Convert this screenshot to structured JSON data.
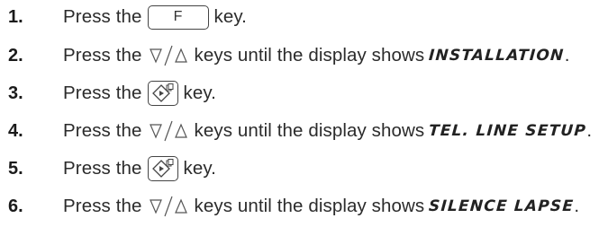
{
  "steps": [
    {
      "number": "1.",
      "text_before": "Press the",
      "key": {
        "label": "F",
        "icon": "f-key"
      },
      "text_after": "key."
    },
    {
      "number": "2.",
      "text_before": "Press the",
      "key": {
        "icon": "down-up-arrow-keys"
      },
      "text_after": "keys until the display shows",
      "display": "INSTALLATION",
      "end": "."
    },
    {
      "number": "3.",
      "text_before": "Press the",
      "key": {
        "icon": "start-copy-key"
      },
      "text_after": "key."
    },
    {
      "number": "4.",
      "text_before": "Press the",
      "key": {
        "icon": "down-up-arrow-keys"
      },
      "text_after": "keys until the display shows",
      "display": "TEL. LINE SETUP",
      "end": "."
    },
    {
      "number": "5.",
      "text_before": "Press the",
      "key": {
        "icon": "start-copy-key"
      },
      "text_after": "key."
    },
    {
      "number": "6.",
      "text_before": "Press the",
      "key": {
        "icon": "down-up-arrow-keys"
      },
      "text_after": "keys until the display shows",
      "display": "SILENCE LAPSE",
      "end": "."
    }
  ]
}
